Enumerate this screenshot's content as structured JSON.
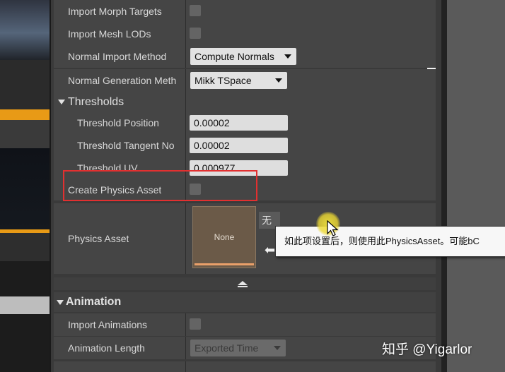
{
  "mesh": {
    "import_morph_targets": {
      "label": "Import Morph Targets",
      "checked": false
    },
    "import_mesh_lods": {
      "label": "Import Mesh LODs",
      "checked": false
    },
    "normal_import_method": {
      "label": "Normal Import Method",
      "value": "Compute Normals"
    },
    "normal_generation_method": {
      "label": "Normal Generation Meth",
      "value": "Mikk TSpace"
    }
  },
  "thresholds": {
    "header": "Thresholds",
    "position": {
      "label": "Threshold Position",
      "value": "0.00002"
    },
    "tangent_normal": {
      "label": "Threshold Tangent No",
      "value": "0.00002"
    },
    "uv": {
      "label": "Threshold UV",
      "value": "0.000977"
    }
  },
  "create_physics_asset": {
    "label": "Create Physics Asset",
    "checked": false
  },
  "physics_asset": {
    "label": "Physics Asset",
    "thumbnail_text": "None",
    "combo_value": "无"
  },
  "tooltip": {
    "text": "如此项设置后，则使用此PhysicsAsset。可能bC"
  },
  "animation": {
    "header": "Animation",
    "import_animations": {
      "label": "Import Animations",
      "checked": false
    },
    "animation_length": {
      "label": "Animation Length",
      "value": "Exported Time"
    }
  },
  "watermark": {
    "text": "知乎 @Yigarlor"
  },
  "colors": {
    "panel_bg": "#3a3a3a",
    "row_bg": "#454545",
    "highlight": "#e23030",
    "accent_orange": "#e89a16"
  },
  "icons": {
    "expand_toggle": "triangle-down-icon",
    "collapse_toggle": "triangle-up-icon",
    "use_selected": "arrow-left-icon",
    "cursor": "mouse-cursor-icon"
  }
}
